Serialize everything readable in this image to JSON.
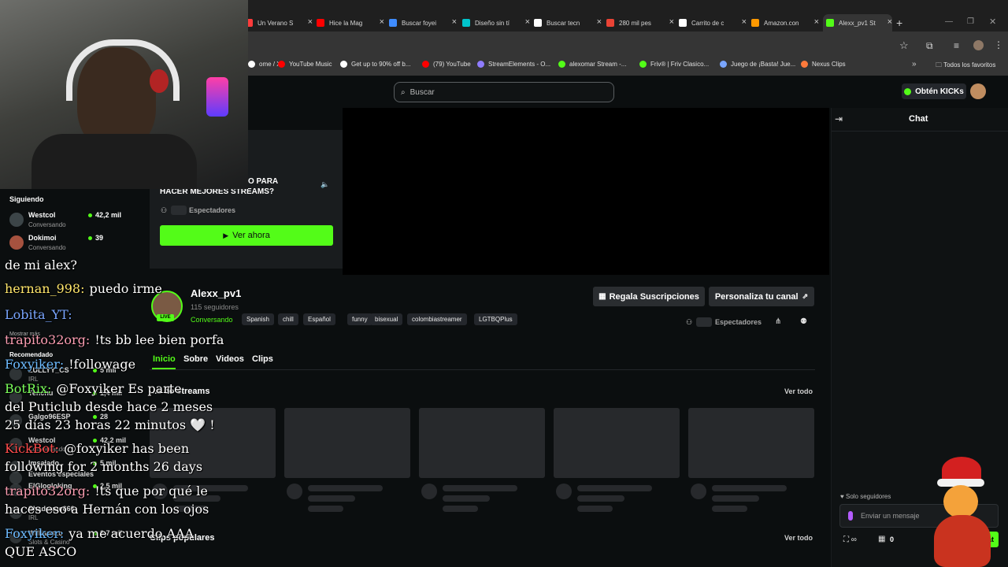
{
  "browser": {
    "tabs": [
      {
        "label": "Un Verano S",
        "color": "#ff3b3b"
      },
      {
        "label": "Hice la Mag",
        "color": "#ff0000"
      },
      {
        "label": "Buscar foyei",
        "color": "#3f8cff"
      },
      {
        "label": "Diseño sin tí",
        "color": "#00c4cc"
      },
      {
        "label": "Buscar tecn",
        "color": "#ffffff"
      },
      {
        "label": "280 mil pes",
        "color": "#ea4335"
      },
      {
        "label": "Carrito de c",
        "color": "#ffffff"
      },
      {
        "label": "Amazon.con",
        "color": "#ff9900"
      },
      {
        "label": "Alexx_pv1 St",
        "color": "#53fc18"
      }
    ],
    "bookmarks": [
      {
        "label": "ome / X",
        "color": "#ffffff"
      },
      {
        "label": "YouTube Music",
        "color": "#ff0000"
      },
      {
        "label": "Get up to 90% off b...",
        "color": "#ffffff"
      },
      {
        "label": "(79) YouTube",
        "color": "#ff0000"
      },
      {
        "label": "StreamElements - O...",
        "color": "#8f7cff"
      },
      {
        "label": "alexomar Stream -...",
        "color": "#53fc18"
      },
      {
        "label": "Friv® | Friv Clasico...",
        "color": "#53fc18"
      },
      {
        "label": "Juego de ¡Basta! Jue...",
        "color": "#7aa6ff"
      },
      {
        "label": "Nexus Clips",
        "color": "#ff7a3b"
      }
    ],
    "all_bookmarks": "Todos los favoritos"
  },
  "header": {
    "search_placeholder": "Buscar",
    "kicks_button": "Obtén KICKs"
  },
  "offline_card": {
    "title_line1": "O PARA",
    "title_line2": "HACER MEJORES STREAMS?",
    "viewers_label": "Espectadores",
    "watch_button": "Ver ahora"
  },
  "sidebar": {
    "following_title": "Siguiendo",
    "following": [
      {
        "name": "Westcol",
        "sub": "Conversando",
        "count": "42,2 mil"
      },
      {
        "name": "Dokimoi",
        "sub": "Conversando",
        "count": "39"
      }
    ],
    "show_more": "Mostrar más",
    "recommended_title": "Recomendado",
    "recommended": [
      {
        "name": "ZULLYY_CS",
        "sub": "IRL",
        "count": "5 mil"
      },
      {
        "name": "Tenchu",
        "sub": "",
        "count": "1,4 mil"
      },
      {
        "name": "Galgo96ESP",
        "sub": "",
        "count": "28"
      },
      {
        "name": "Westcol",
        "sub": "Conversando",
        "count": "42,2 mil"
      },
      {
        "name": "Imsalado",
        "sub": "",
        "count": "5 mil"
      },
      {
        "name": "Eventos especiales",
        "sub": "",
        "count": ""
      },
      {
        "name": "ElGlogloking",
        "sub": "",
        "count": "2,5 mil"
      },
      {
        "name": "Shadoune666",
        "sub": "IRL",
        "count": ""
      },
      {
        "name": "Willianszc",
        "sub": "Slots & Casino",
        "count": "3,7 mil"
      }
    ]
  },
  "channel": {
    "name": "Alexx_pv1",
    "followers": "115 seguidores",
    "live_badge": "LIVE",
    "category": "Conversando",
    "tags": [
      "Spanish",
      "chill",
      "Español",
      "funny",
      "bisexual",
      "colombiastreamer",
      "LGTBQPlus"
    ],
    "gift_button": "Regala Suscripciones",
    "customize_button": "Personaliza tu canal",
    "viewers_label": "Espectadores",
    "nav_tabs": [
      "Inicio",
      "Sobre",
      "Videos",
      "Clips"
    ],
    "recent_title": "...s de streams",
    "popular_title": "Clips populares",
    "see_all": "Ver todo"
  },
  "chat": {
    "title": "Chat",
    "followers_only": "Solo seguidores",
    "input_placeholder": "Enviar un mensaje",
    "points": "0",
    "send_label": "hat"
  },
  "overlay_chat": [
    {
      "user": "",
      "text": "de mi alex?",
      "user_color": "#ffffff"
    },
    {
      "user": "hernan_998",
      "text": "puedo irme",
      "user_color": "#ffe66b"
    },
    {
      "user": "Lobita_YT",
      "text": "",
      "user_color": "#7aa6ff"
    },
    {
      "user": "trapito32org",
      "text": "!ts bb lee bien porfa",
      "user_color": "#ff9fb4"
    },
    {
      "user": "Foxyiker",
      "text": "!followage",
      "user_color": "#6dbbff"
    },
    {
      "user": "BotRix",
      "text": "@Foxyiker Es parte",
      "user_color": "#7bff5b"
    },
    {
      "user": "",
      "text": "del Puticlub desde hace 2 meses",
      "user_color": "#ffffff"
    },
    {
      "user": "",
      "text": "25 días 23 horas 22 minutos 🤍 !",
      "user_color": "#ffffff"
    },
    {
      "user": "KickBot",
      "text": "@foxyiker has been",
      "user_color": "#ff4b4b"
    },
    {
      "user": "",
      "text": "following for 2 months 26 days",
      "user_color": "#ffffff"
    },
    {
      "user": "trapito32org",
      "text": "!ts que por qué le",
      "user_color": "#ff9fb4"
    },
    {
      "user": "",
      "text": "haces eso a Hernán con los ojos",
      "user_color": "#ffffff"
    },
    {
      "user": "Foxyiker",
      "text": "ya me acuerdo AAA",
      "user_color": "#6dbbff"
    },
    {
      "user": "",
      "text": "QUE ASCO",
      "user_color": "#ffffff"
    }
  ]
}
